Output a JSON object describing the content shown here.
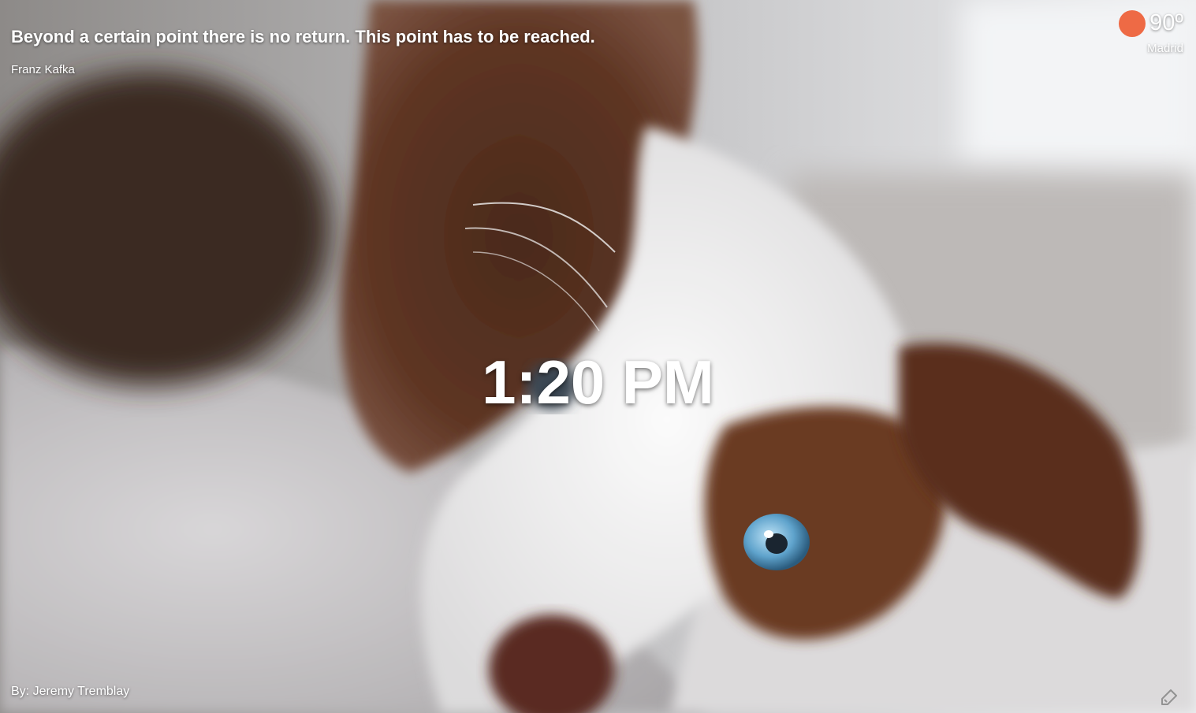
{
  "quote": {
    "text": "Beyond a certain point there is no return. This point has to be reached.",
    "author": "Franz Kafka"
  },
  "weather": {
    "temperature": "90º",
    "city": "Madrid",
    "icon": "sun-icon",
    "icon_color": "#ee6a45"
  },
  "clock": {
    "time": "1:20 PM"
  },
  "photo_credit": {
    "text": "By: Jeremy Tremblay"
  },
  "corner_icon": {
    "icon": "pencil-icon"
  }
}
